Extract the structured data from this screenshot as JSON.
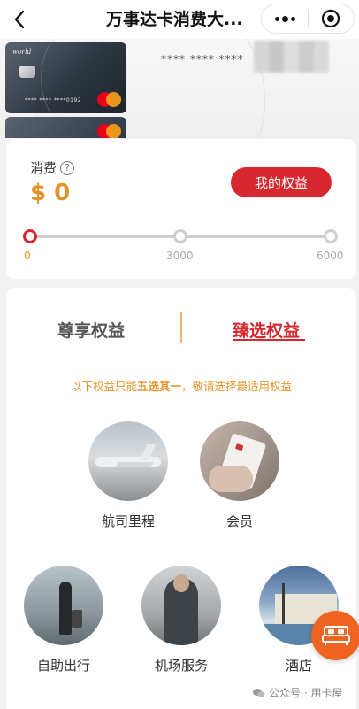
{
  "nav": {
    "title": "万事达卡消费大...",
    "back_icon": "chevron-left-icon",
    "more_icon": "more-dots-icon",
    "close_icon": "mini-program-close-icon"
  },
  "card": {
    "brand_text": "world",
    "card_number": "**** **** ****0192",
    "masked_number": "**** **** ****",
    "network": "mastercard"
  },
  "spend": {
    "label": "消费",
    "help_icon": "question-circle-icon",
    "amount": "$ 0",
    "my_rights_button": "我的权益",
    "progress_fraction": 0,
    "milestones": [
      "0",
      "3000",
      "6000"
    ]
  },
  "tabs": {
    "items": [
      {
        "label": "尊享权益",
        "active": false
      },
      {
        "label": "臻选权益",
        "active": true
      }
    ]
  },
  "notice": {
    "prefix": "以下权益只能",
    "highlight": "五选其一",
    "suffix": "，敬请选择最适用权益"
  },
  "benefits": [
    {
      "label": "航司里程",
      "icon": "airplane-photo"
    },
    {
      "label": "会员",
      "icon": "membership-card-photo"
    },
    {
      "label": "自助出行",
      "icon": "traveler-photo"
    },
    {
      "label": "机场服务",
      "icon": "airport-service-photo"
    },
    {
      "label": "酒店",
      "icon": "hotel-photo"
    }
  ],
  "fab_icon": "bed-icon",
  "watermark": {
    "text": "公众号 · 用卡屋",
    "icon": "wechat-icon"
  },
  "colors": {
    "accent_red": "#d7282f",
    "accent_orange": "#e4932b",
    "fab_orange": "#f06421"
  }
}
